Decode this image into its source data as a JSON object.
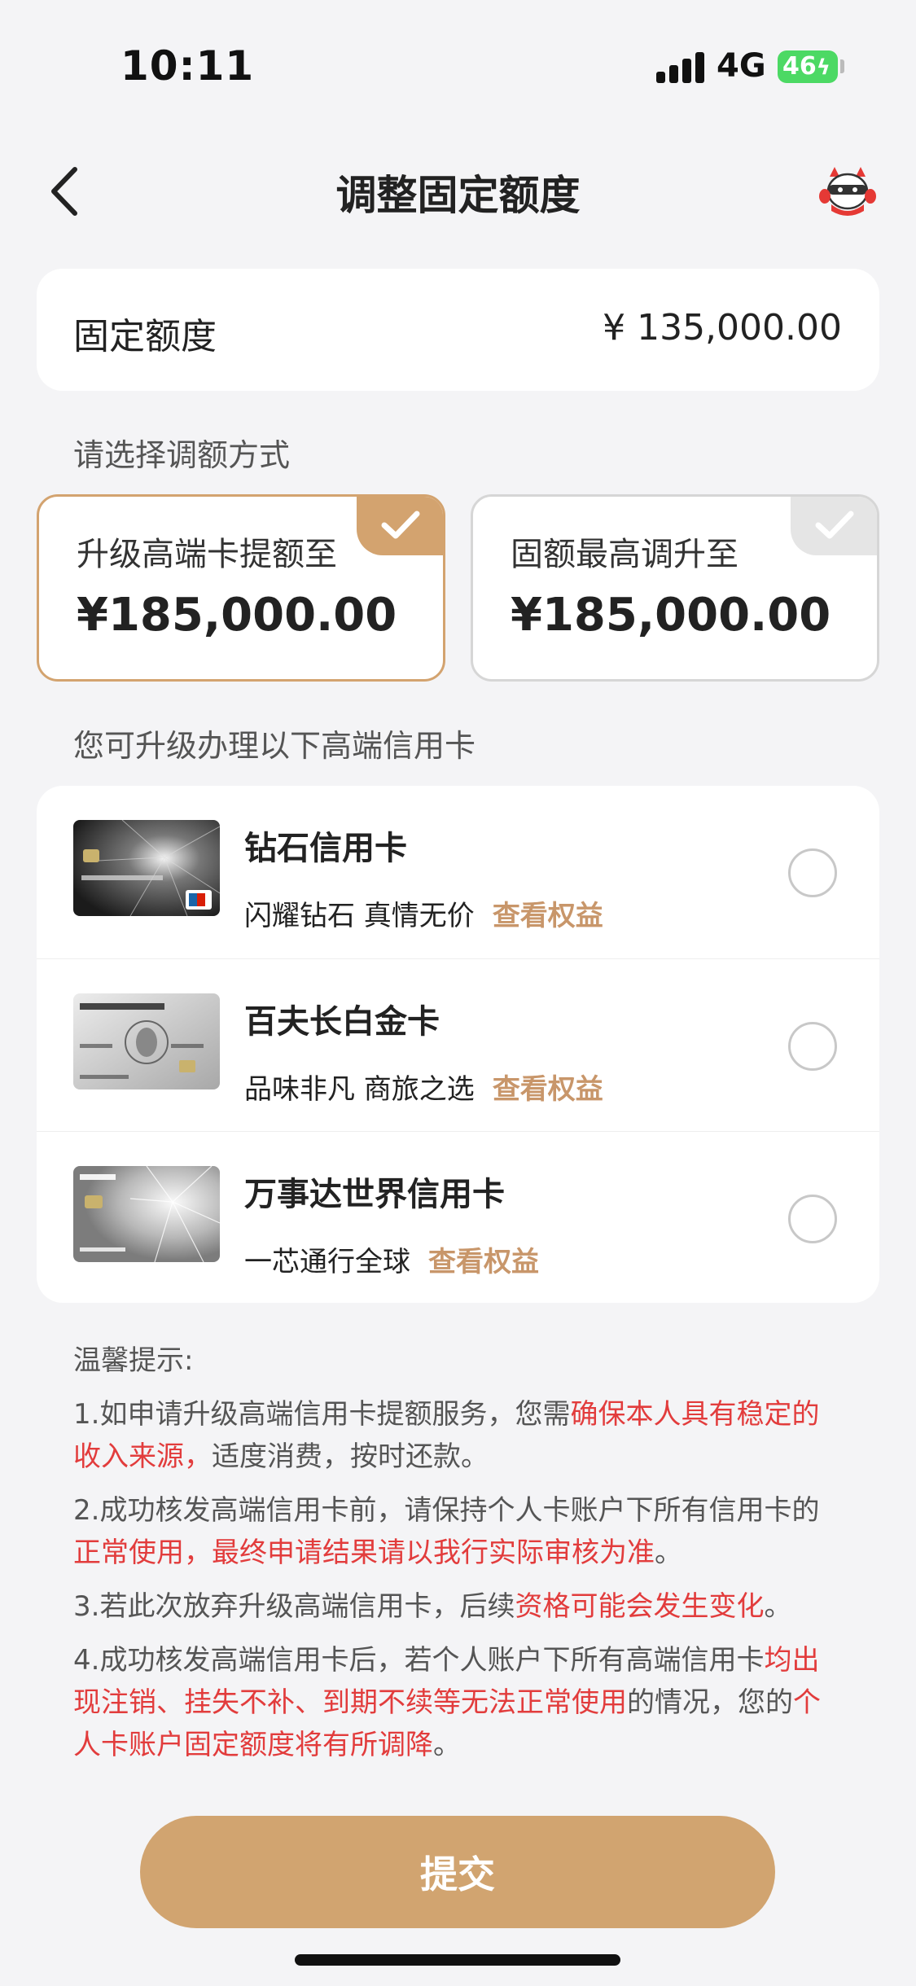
{
  "status_bar": {
    "time": "10:11",
    "network": "4G",
    "battery": "46"
  },
  "nav": {
    "title": "调整固定额度"
  },
  "limit": {
    "label": "固定额度",
    "value": "¥ 135,000.00"
  },
  "adjust": {
    "section_label": "请选择调额方式",
    "options": [
      {
        "label": "升级高端卡提额至",
        "value": "¥185,000.00",
        "selected": true
      },
      {
        "label": "固额最高调升至",
        "value": "¥185,000.00",
        "selected": false
      }
    ]
  },
  "cards": {
    "section_label": "您可升级办理以下高端信用卡",
    "items": [
      {
        "name": "钻石信用卡",
        "desc": "闪耀钻石 真情无价",
        "link": "查看权益"
      },
      {
        "name": "百夫长白金卡",
        "desc": "品味非凡 商旅之选",
        "link": "查看权益"
      },
      {
        "name": "万事达世界信用卡",
        "desc": "一芯通行全球",
        "link": "查看权益"
      }
    ]
  },
  "tips": {
    "title": "温馨提示:",
    "items": [
      {
        "parts": [
          {
            "text": "1.如申请升级高端信用卡提额服务，您需"
          },
          {
            "text": "确保本人具有稳定的收入来源，",
            "hl": true
          },
          {
            "text": "适度消费，按时还款。"
          }
        ]
      },
      {
        "parts": [
          {
            "text": "2.成功核发高端信用卡前，请保持个人卡账户下所有信用卡的"
          },
          {
            "text": "正常使用，最终申请结果请以我行实际审核为准",
            "hl": true
          },
          {
            "text": "。"
          }
        ]
      },
      {
        "parts": [
          {
            "text": "3.若此次放弃升级高端信用卡，后续"
          },
          {
            "text": "资格可能会发生变化",
            "hl": true
          },
          {
            "text": "。"
          }
        ]
      },
      {
        "parts": [
          {
            "text": "4.成功核发高端信用卡后，若个人账户下所有高端信用卡"
          },
          {
            "text": "均出现注销、挂失不补、到期不续等无法正常使用",
            "hl": true
          },
          {
            "text": "的情况，您的"
          },
          {
            "text": "个人卡账户固定额度将有所调降",
            "hl": true
          },
          {
            "text": "。"
          }
        ]
      }
    ]
  },
  "submit": {
    "label": "提交"
  },
  "colors": {
    "accent": "#d3a36f",
    "link": "#c8966a",
    "warning": "#e23c3c",
    "background": "#f4f4f6"
  },
  "icons": {
    "back": "chevron-left-icon",
    "assistant": "mascot-icon",
    "check": "check-icon"
  }
}
